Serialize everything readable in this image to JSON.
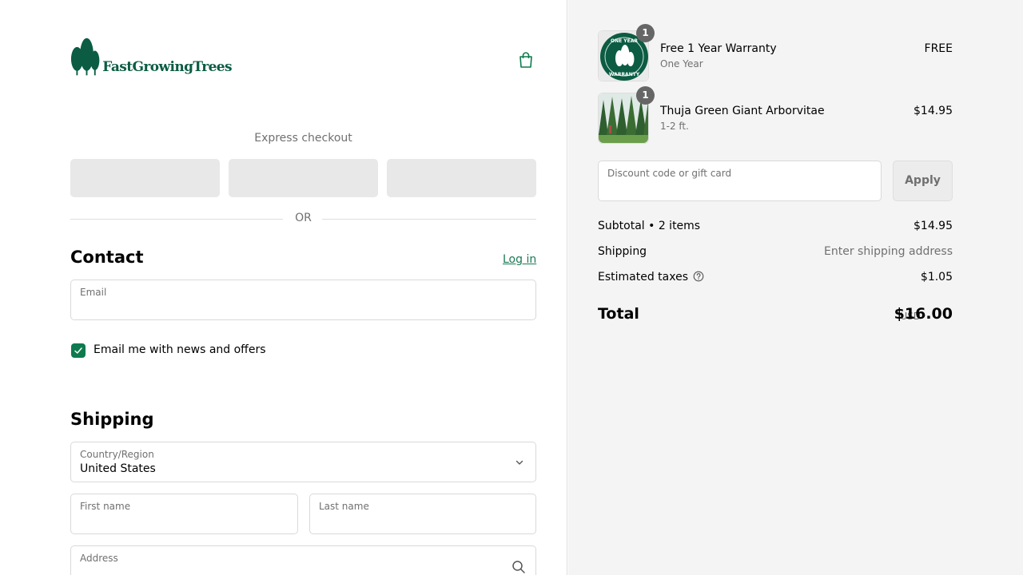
{
  "brand": {
    "logo_text": "FastGrowingTrees",
    "color": "#0b5c43"
  },
  "icons": {
    "cart": "shopping-bag-icon",
    "chevron": "chevron-down-icon",
    "search": "search-icon",
    "help": "question-circle-icon",
    "check": "check-icon"
  },
  "express": {
    "title": "Express checkout",
    "divider": "OR"
  },
  "contact": {
    "title": "Contact",
    "login": "Log in",
    "email_label": "Email",
    "email_value": "",
    "newsletter_label": "Email me with news and offers",
    "newsletter_checked": true
  },
  "shipping": {
    "title": "Shipping",
    "country_label": "Country/Region",
    "country_value": "United States",
    "first_name_label": "First name",
    "last_name_label": "Last name",
    "address_label": "Address"
  },
  "cart": {
    "items": [
      {
        "quantity": "1",
        "name": "Free 1 Year Warranty",
        "variant": "One Year",
        "price": "FREE",
        "thumb_text_top": "ONE YEAR",
        "thumb_text_bottom": "WARRANTY"
      },
      {
        "quantity": "1",
        "name": "Thuja Green Giant Arborvitae",
        "variant": "1-2 ft.",
        "price": "$14.95"
      }
    ],
    "discount_placeholder": "Discount code or gift card",
    "apply_label": "Apply",
    "subtotal_label": "Subtotal • 2 items",
    "subtotal_value": "$14.95",
    "shipping_label": "Shipping",
    "shipping_value": "Enter shipping address",
    "taxes_label": "Estimated taxes",
    "taxes_value": "$1.05",
    "total_label": "Total",
    "currency": "USD",
    "total_value": "$16.00"
  },
  "colors": {
    "accent": "#0e7a4e",
    "link": "#1a7a55",
    "sidebar_bg": "#f4f4f4"
  }
}
